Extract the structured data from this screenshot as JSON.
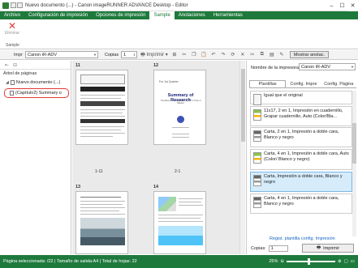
{
  "window": {
    "title": "Nuevo documento (...) - Canon imageRUNNER ADVANCE Desktop - Editor"
  },
  "menubar": {
    "items": [
      {
        "label": "Archivo",
        "active": false
      },
      {
        "label": "Configuración de impresión",
        "active": false
      },
      {
        "label": "Opciones de impresión",
        "active": false
      },
      {
        "label": "Sample",
        "active": true
      },
      {
        "label": "Anotaciones",
        "active": false
      },
      {
        "label": "Herramientas",
        "active": false
      }
    ]
  },
  "ribbon": {
    "delete_label": "Eliminar",
    "group_label": "Sample"
  },
  "toolbar": {
    "printer_label": "Impr",
    "printer_value": "Canon iR-ADV",
    "copies_label": "Copias",
    "copies_value": "1",
    "print_label": "Imprimir",
    "show_annotations_label": "Mostrar anotac."
  },
  "left_panel": {
    "tree_title": "Árbol de páginas",
    "root_label": "Nuevo documento (...)",
    "child_label": "(Capítulo2) Summary o"
  },
  "pages": [
    {
      "num": "11",
      "caption": "1-11"
    },
    {
      "num": "12",
      "caption": "2-1"
    },
    {
      "num": "13",
      "caption": ""
    },
    {
      "num": "14",
      "caption": ""
    }
  ],
  "page12": {
    "top": "For 1st Quarter",
    "title": "Summary of Research",
    "sub": "The Effect of the Integration of ISP in Tribe of Nagano"
  },
  "right_panel": {
    "printer_name_label": "Nombre de la impresora:",
    "printer_value": "Canon iR-ADV",
    "tabs": [
      "Plantillas",
      "Config. Impre",
      "Config. Página"
    ],
    "templates": [
      {
        "text": "Igual que el original",
        "icon": "plain",
        "selected": false
      },
      {
        "text": "11x17, 2 en 1, Impresión en cuadernillo, Grapar cuadernillo, Auto (Color/Bla...",
        "icon": "col",
        "selected": false
      },
      {
        "text": "Carta, 2 en 1, Impresión a doble cara, Blanco y negro",
        "icon": "bw",
        "selected": false
      },
      {
        "text": "Carta, 4 en 1, Impresión a doble cara, Auto (Color/ Blanco y negro)",
        "icon": "col",
        "selected": false
      },
      {
        "text": "Carta, Impresión a doble cara, Blanco y negro",
        "icon": "bw",
        "selected": true
      },
      {
        "text": "Carta, 4 en 1, Impresión a doble cara, Blanco y negro",
        "icon": "bw",
        "selected": false
      }
    ],
    "link": "Regist. plantilla config. Impresión",
    "copies_label": "Copias:",
    "copies_value": "1",
    "print_button": "Imprimir"
  },
  "statusbar": {
    "text": "Página seleccionada: /22  |  Tamaño de salida:A4  |  Total de hojas: 22",
    "zoom": "25%"
  }
}
